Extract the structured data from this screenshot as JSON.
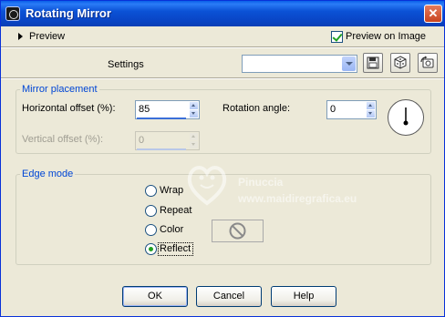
{
  "window": {
    "title": "Rotating Mirror",
    "close_glyph": "✕"
  },
  "preview": {
    "label": "Preview",
    "preview_on_image_label": "Preview on Image",
    "preview_on_image_checked": true
  },
  "settings": {
    "label": "Settings",
    "preset_value": "",
    "tool_icons": [
      "save-preset-icon",
      "randomize-icon",
      "reset-icon"
    ]
  },
  "mirror_placement": {
    "title": "Mirror placement",
    "horizontal_offset_label": "Horizontal offset (%):",
    "horizontal_offset_value": "85",
    "vertical_offset_label": "Vertical offset (%):",
    "vertical_offset_value": "0",
    "vertical_offset_disabled": true,
    "rotation_angle_label": "Rotation angle:",
    "rotation_angle_value": "0"
  },
  "edge_mode": {
    "title": "Edge mode",
    "options": [
      {
        "label": "Wrap",
        "selected": false
      },
      {
        "label": "Repeat",
        "selected": false
      },
      {
        "label": "Color",
        "selected": false
      },
      {
        "label": "Reflect",
        "selected": true
      }
    ],
    "color_swatch_icon": "no-color-icon"
  },
  "buttons": {
    "ok": "OK",
    "cancel": "Cancel",
    "help": "Help"
  },
  "watermark": {
    "line1": "Pinuccia",
    "line2": "www.maidiregrafica.eu"
  },
  "colors": {
    "titlebar": "#0a52d6",
    "dialog_bg": "#ece9d8",
    "group_title": "#0046d5",
    "check_green": "#21a121"
  }
}
